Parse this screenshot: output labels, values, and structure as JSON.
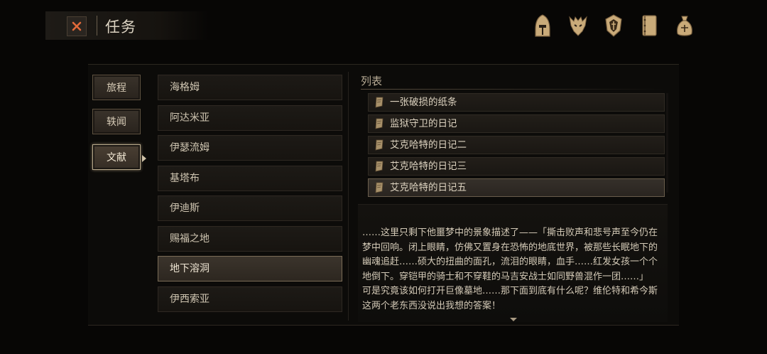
{
  "header": {
    "title": "任务",
    "close_icon": "close-x-icon",
    "accent_color": "#e26a3a"
  },
  "top_icons": [
    {
      "name": "helmet-icon"
    },
    {
      "name": "beast-head-icon"
    },
    {
      "name": "crest-shield-icon"
    },
    {
      "name": "journal-book-icon"
    },
    {
      "name": "money-bag-icon"
    }
  ],
  "categories": [
    {
      "label": "旅程",
      "active": false
    },
    {
      "label": "轶闻",
      "active": false
    },
    {
      "label": "文献",
      "active": true
    }
  ],
  "locations": [
    {
      "label": "海格姆",
      "active": false
    },
    {
      "label": "阿达米亚",
      "active": false
    },
    {
      "label": "伊瑟流姆",
      "active": false
    },
    {
      "label": "基塔布",
      "active": false
    },
    {
      "label": "伊迪斯",
      "active": false
    },
    {
      "label": "赐福之地",
      "active": false
    },
    {
      "label": "地下溶洞",
      "active": true
    },
    {
      "label": "伊西索亚",
      "active": false
    }
  ],
  "document_list": {
    "heading": "列表",
    "items": [
      {
        "label": "一张破损的纸条",
        "active": false
      },
      {
        "label": "监狱守卫的日记",
        "active": false
      },
      {
        "label": "艾克哈特的日记二",
        "active": false
      },
      {
        "label": "艾克哈特的日记三",
        "active": false
      },
      {
        "label": "艾克哈特的日记五",
        "active": true
      }
    ]
  },
  "document_text": "……这里只剩下他噩梦中的景象描述了——「撕击败声和悲号声至今仍在梦中回响。闭上眼睛，仿佛又置身在恐怖的地底世界，被那些长眠地下的幽魂追赶……硕大的扭曲的面孔，流泪的眼睛，血手……红发女孩一个个地倒下。穿铠甲的骑士和不穿鞋的马吉安战士如同野兽混作一团……」\n可是究竟该如何打开巨像墓地……那下面到底有什么呢？维伦特和希今斯这两个老东西没说出我想的答案！"
}
